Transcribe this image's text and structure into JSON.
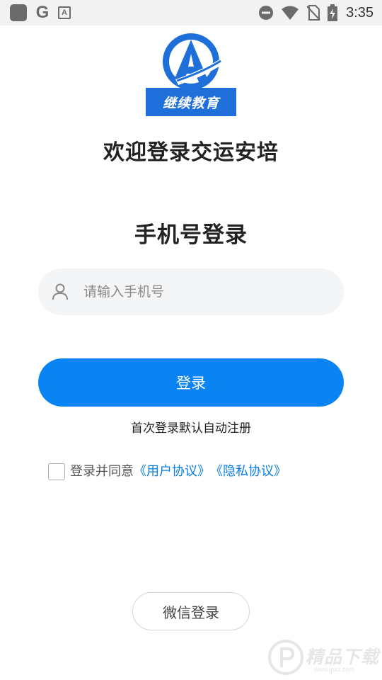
{
  "status_bar": {
    "time": "3:35",
    "left_icons": [
      "app-square-icon",
      "google-icon",
      "text-a-icon"
    ],
    "left_g": "G",
    "left_a": "A",
    "right_icons": [
      "do-not-disturb-icon",
      "wifi-icon",
      "no-sim-icon",
      "battery-charging-icon"
    ]
  },
  "logo": {
    "banner_text": "继续教育",
    "brand_color": "#1e6fd9"
  },
  "welcome_title": "欢迎登录交运安培",
  "login_title": "手机号登录",
  "phone_field": {
    "placeholder": "请输入手机号",
    "value": "",
    "icon": "user-icon"
  },
  "login_button": {
    "label": "登录",
    "color": "#0b84f3"
  },
  "auto_register_hint": "首次登录默认自动注册",
  "agreement": {
    "checked": false,
    "prefix": "登录并同意",
    "user_agreement": "《用户协议》",
    "privacy_policy": "《隐私协议》",
    "link_color": "#0b7fe8"
  },
  "wechat_login_label": "微信登录",
  "watermark": {
    "text": "精品下载",
    "url": "www.jpxz.com"
  }
}
